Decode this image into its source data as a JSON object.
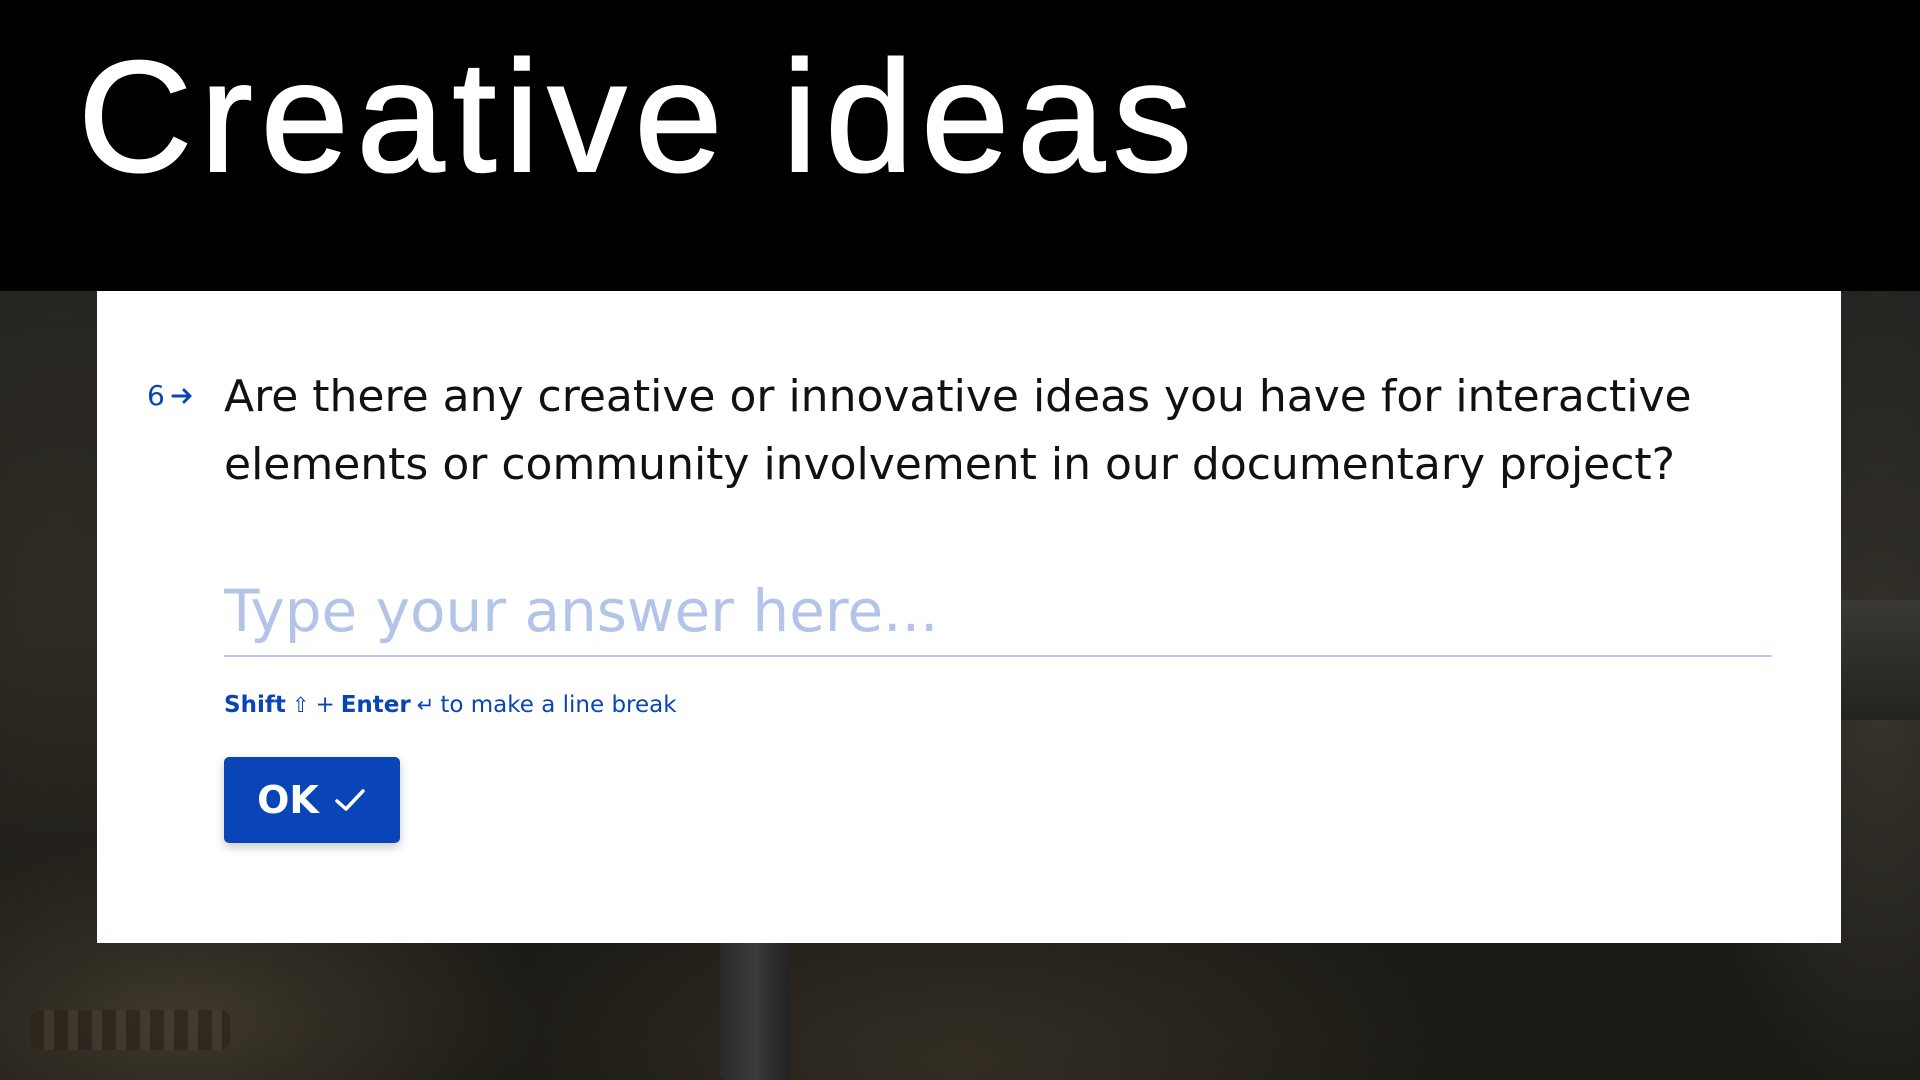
{
  "banner": {
    "headline": "Creative ideas"
  },
  "question": {
    "number": "6",
    "text": "Are there any creative or innovative ideas you have for interactive elements or community involvement in our documentary project?"
  },
  "answer": {
    "placeholder": "Type your answer here..."
  },
  "hint": {
    "shift_label": "Shift",
    "shift_glyph": "⇧",
    "plus": "+",
    "enter_label": "Enter",
    "enter_glyph": "↵",
    "suffix": "to make a line break"
  },
  "submit": {
    "label": "OK"
  },
  "icons": {
    "question_arrow": "arrow-right-icon",
    "ok_check": "checkmark-icon"
  },
  "colors": {
    "accent": "#0a45b8",
    "placeholder": "#b3c4e8",
    "banner_bg": "#000000",
    "card_bg": "#ffffff"
  }
}
